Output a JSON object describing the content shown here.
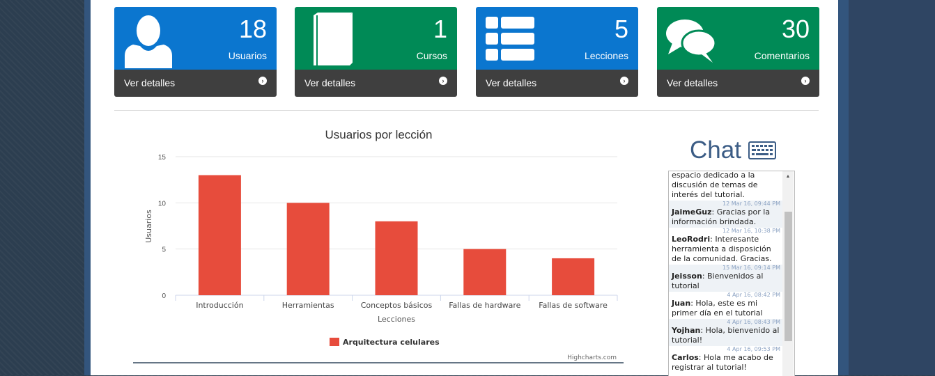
{
  "cards": [
    {
      "count": "18",
      "label": "Usuarios",
      "footer": "Ver detalles",
      "icon": "user-icon"
    },
    {
      "count": "1",
      "label": "Cursos",
      "footer": "Ver detalles",
      "icon": "book-icon"
    },
    {
      "count": "5",
      "label": "Lecciones",
      "footer": "Ver detalles",
      "icon": "list-icon"
    },
    {
      "count": "30",
      "label": "Comentarios",
      "footer": "Ver detalles",
      "icon": "comments-icon"
    }
  ],
  "colors": {
    "blue": "#0b76cf",
    "green": "#008a56",
    "bar": "#e74c3c",
    "footer": "#3f3f3f"
  },
  "chat": {
    "title": "Chat",
    "icon": "keyboard-icon",
    "messages": [
      {
        "time": "",
        "user": "",
        "text": "espacio dedicado a la discusión de temas de interés del tutorial."
      },
      {
        "time": "12 Mar 16, 09:44 PM",
        "user": "JaimeGuz",
        "text": "Gracias por la información brindada."
      },
      {
        "time": "12 Mar 16, 10:38 PM",
        "user": "LeoRodri",
        "text": "Interesante herramienta a disposición de la comunidad. Gracias."
      },
      {
        "time": "15 Mar 16, 09:14 PM",
        "user": "Jeisson",
        "text": "Bienvenidos al tutorial"
      },
      {
        "time": "4 Apr 16, 08:42 PM",
        "user": "Juan",
        "text": "Hola, este es mi primer día en el tutorial"
      },
      {
        "time": "4 Apr 16, 08:43 PM",
        "user": "Yojhan",
        "text": "Hola, bienvenido al tutorial!"
      },
      {
        "time": "4 Apr 16, 09:53 PM",
        "user": "Carlos",
        "text": "Hola me acabo de registrar al tutorial!"
      }
    ]
  },
  "chart_data": {
    "type": "bar",
    "title": "Usuarios por lección",
    "xlabel": "Lecciones",
    "ylabel": "Usuarios",
    "categories": [
      "Introducción",
      "Herramientas",
      "Conceptos básicos",
      "Fallas de hardware",
      "Fallas de software"
    ],
    "series": [
      {
        "name": "Arquitectura celulares",
        "values": [
          13,
          10,
          8,
          5,
          4
        ],
        "color": "#e74c3c"
      }
    ],
    "ylim": [
      0,
      15
    ],
    "yticks": [
      0,
      5,
      10,
      15
    ],
    "grid": true,
    "legend": "bottom-center",
    "credits": "Highcharts.com"
  }
}
